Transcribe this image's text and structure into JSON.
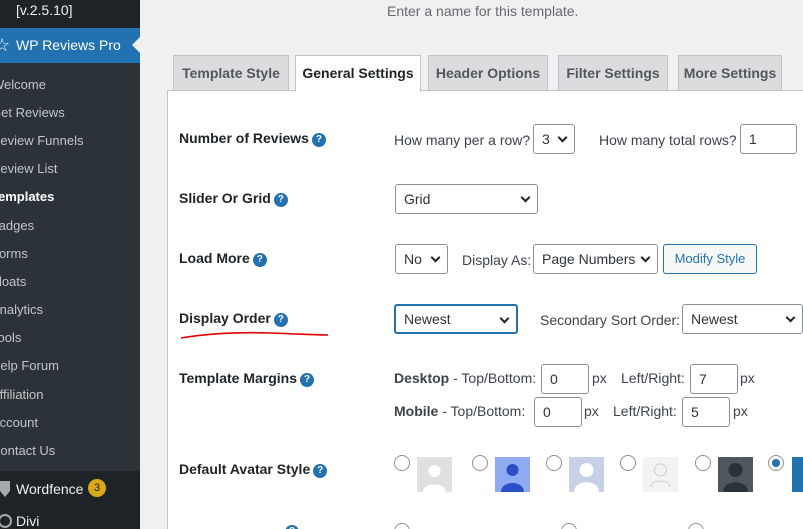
{
  "sidebar": {
    "version": "[v.2.5.10]",
    "active_plugin": "WP Reviews Pro",
    "items": [
      {
        "label": "Welcome"
      },
      {
        "label": "Get Reviews"
      },
      {
        "label": "Review Funnels"
      },
      {
        "label": "Review List"
      },
      {
        "label": "Templates"
      },
      {
        "label": "Badges"
      },
      {
        "label": "Forms"
      },
      {
        "label": "Floats"
      },
      {
        "label": "Analytics"
      },
      {
        "label": "Tools"
      },
      {
        "label": "Help Forum"
      },
      {
        "label": "Affiliation"
      },
      {
        "label": "Account"
      },
      {
        "label": "Contact Us"
      }
    ],
    "wordfence": {
      "label": "Wordfence",
      "badge": "3"
    },
    "divi": {
      "label": "Divi"
    }
  },
  "main": {
    "help_text": "Enter a name for this template.",
    "tabs": [
      {
        "label": "Template Style"
      },
      {
        "label": "General Settings"
      },
      {
        "label": "Header Options"
      },
      {
        "label": "Filter Settings"
      },
      {
        "label": "More Settings"
      }
    ],
    "number_of_reviews": {
      "label": "Number of Reviews",
      "per_row_label": "How many per a row?",
      "per_row_value": "3",
      "total_rows_label": "How many total rows?",
      "total_rows_value": "1"
    },
    "slider_or_grid": {
      "label": "Slider Or Grid",
      "value": "Grid"
    },
    "load_more": {
      "label": "Load More",
      "value": "No",
      "display_as_label": "Display As:",
      "display_as_value": "Page Numbers",
      "modify_style_label": "Modify Style"
    },
    "display_order": {
      "label": "Display Order",
      "value": "Newest",
      "secondary_label": "Secondary Sort Order:",
      "secondary_value": "Newest"
    },
    "template_margins": {
      "label": "Template Margins",
      "desktop_label": "Desktop",
      "desktop_tb_label": " - Top/Bottom:",
      "desktop_tb_value": "0",
      "desktop_lr_label": "Left/Right:",
      "desktop_lr_value": "7",
      "mobile_label": "Mobile",
      "mobile_tb_label": " - Top/Bottom:",
      "mobile_tb_value": "0",
      "mobile_lr_label": "Left/Right:",
      "mobile_lr_value": "5",
      "unit": "px"
    },
    "avatar_style": {
      "label": "Default Avatar Style",
      "selected_index": 5
    },
    "colors": {
      "accent": "#2271b1",
      "sidebar_bg": "#1d2327",
      "annotation": "#e00000"
    }
  }
}
